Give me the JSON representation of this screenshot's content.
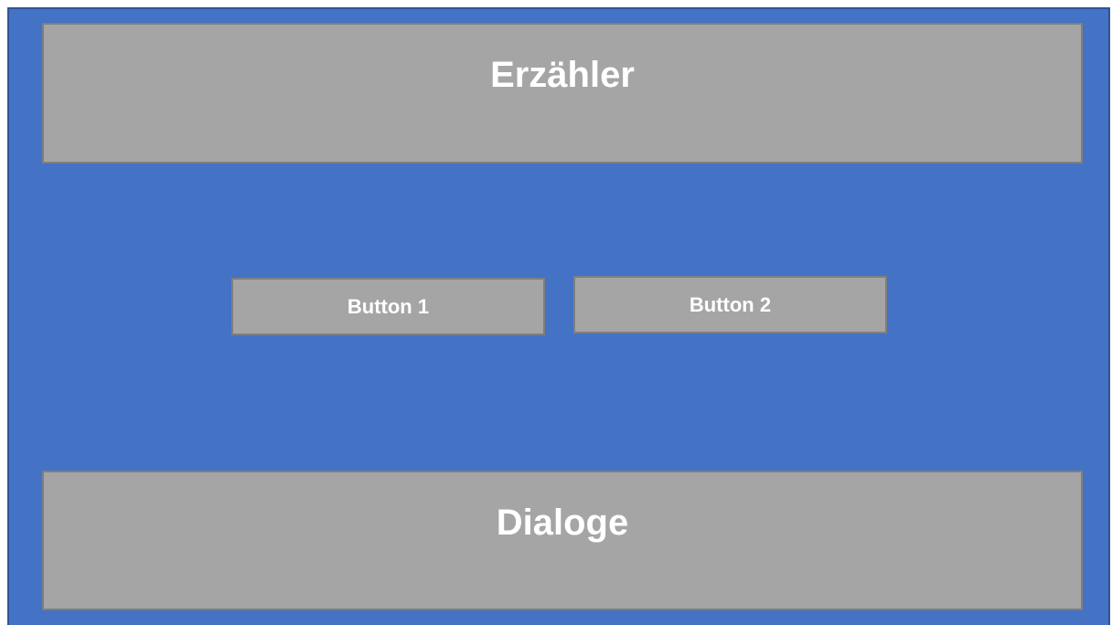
{
  "narrator": {
    "title": "Erzähler"
  },
  "buttons": [
    {
      "label": "Button 1"
    },
    {
      "label": "Button 2"
    }
  ],
  "dialogue": {
    "title": "Dialoge"
  },
  "colors": {
    "background": "#4472C4",
    "panel": "#A5A5A5",
    "panel_border": "#7F7F7F",
    "text": "#FFFFFF"
  }
}
